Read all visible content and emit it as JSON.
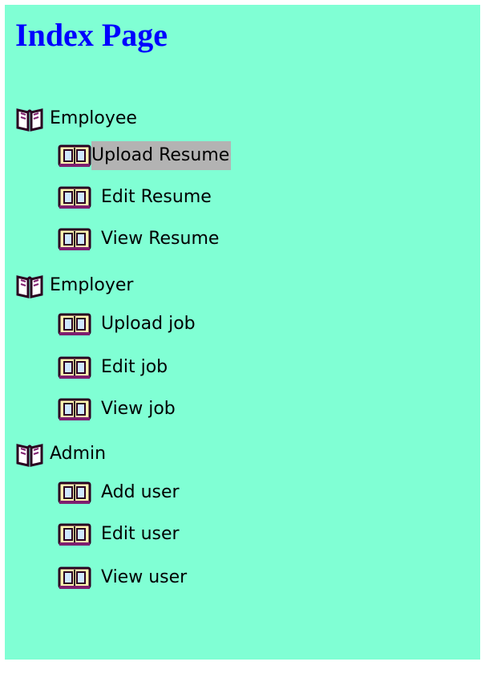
{
  "page": {
    "title": "Index Page"
  },
  "colors": {
    "background": "#80ffd4",
    "title": "#0000ff",
    "highlight": "#b3b3b3"
  },
  "tree": [
    {
      "label": "Employee",
      "icon": "open-book-icon",
      "children": [
        {
          "label": "Upload Resume",
          "icon": "book-icon",
          "highlighted": true
        },
        {
          "label": "Edit Resume",
          "icon": "book-icon"
        },
        {
          "label": "View Resume",
          "icon": "book-icon"
        }
      ]
    },
    {
      "label": "Employer",
      "icon": "open-book-icon",
      "children": [
        {
          "label": "Upload job",
          "icon": "book-icon"
        },
        {
          "label": "Edit job",
          "icon": "book-icon"
        },
        {
          "label": "View job",
          "icon": "book-icon"
        }
      ]
    },
    {
      "label": "Admin",
      "icon": "open-book-icon",
      "children": [
        {
          "label": "Add user",
          "icon": "book-icon"
        },
        {
          "label": "Edit user",
          "icon": "book-icon"
        },
        {
          "label": "View user",
          "icon": "book-icon"
        }
      ]
    }
  ]
}
